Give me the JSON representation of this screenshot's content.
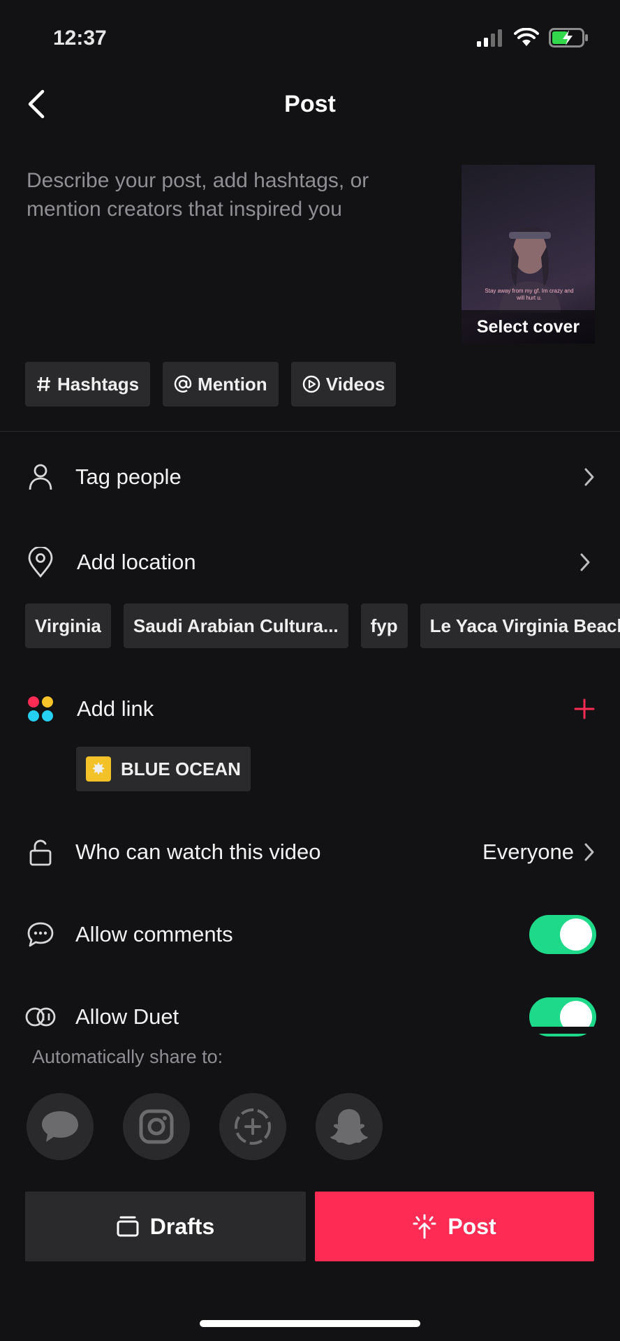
{
  "status_bar": {
    "time": "12:37"
  },
  "header": {
    "title": "Post"
  },
  "description": {
    "placeholder": "Describe your post, add hashtags, or mention creators that inspired you"
  },
  "cover": {
    "label": "Select cover",
    "caption": "Stay away from my gf. Im crazy and will hurt u."
  },
  "chips": [
    {
      "label": "Hashtags",
      "icon": "hash-icon"
    },
    {
      "label": "Mention",
      "icon": "at-icon"
    },
    {
      "label": "Videos",
      "icon": "play-circle-icon"
    }
  ],
  "tag_people": {
    "label": "Tag people"
  },
  "location": {
    "label": "Add location",
    "suggestions": [
      "Virginia",
      "Saudi Arabian Cultura...",
      "fyp",
      "Le Yaca Virginia Beach"
    ]
  },
  "add_link": {
    "label": "Add link",
    "chip_label": "BLUE OCEAN"
  },
  "privacy": {
    "label": "Who can watch this video",
    "value": "Everyone"
  },
  "allow_comments": {
    "label": "Allow comments",
    "enabled": true
  },
  "allow_duet": {
    "label": "Allow Duet",
    "enabled": true
  },
  "share": {
    "label": "Automatically share to:",
    "targets": [
      "messages-icon",
      "instagram-icon",
      "story-icon",
      "snapchat-icon"
    ]
  },
  "actions": {
    "drafts_label": "Drafts",
    "post_label": "Post"
  },
  "colors": {
    "accent": "#fe2c55",
    "toggle_on": "#1fd98a",
    "background": "#121214",
    "chip": "#2a2a2c"
  }
}
